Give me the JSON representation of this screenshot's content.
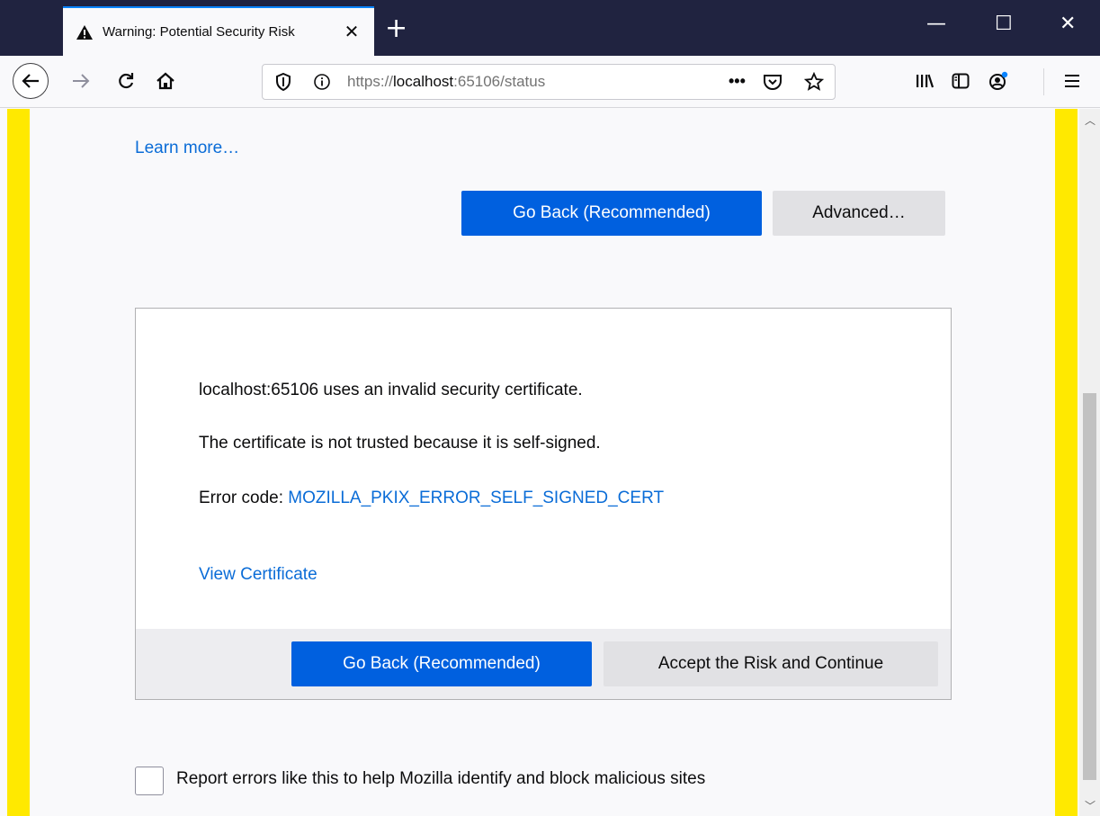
{
  "browser": {
    "tab_title": "Warning: Potential Security Risk",
    "tab_close": "✕",
    "new_tab": "+",
    "window_controls": {
      "minimize": "—",
      "maximize": "☐",
      "close": "✕"
    },
    "url": {
      "prefix": "https://",
      "host": "localhost",
      "rest": ":65106/status"
    },
    "icons": [
      "warning-icon",
      "back-icon",
      "forward-icon",
      "reload-icon",
      "home-icon",
      "shield-icon",
      "info-icon",
      "more-actions-icon",
      "pocket-icon",
      "bookmark-star-icon",
      "library-icon",
      "sidebar-icon",
      "account-icon",
      "menu-icon"
    ]
  },
  "page": {
    "learn_more": "Learn more…",
    "go_back_label": "Go Back (Recommended)",
    "advanced_label": "Advanced…",
    "panel": {
      "line1": "localhost:65106 uses an invalid security certificate.",
      "line2": "The certificate is not trusted because it is self-signed.",
      "error_prefix": "Error code: ",
      "error_code": "MOZILLA_PKIX_ERROR_SELF_SIGNED_CERT",
      "view_certificate": "View Certificate",
      "go_back_label": "Go Back (Recommended)",
      "accept_label": "Accept the Risk and Continue"
    },
    "report_label": "Report errors like this to help Mozilla identify and block malicious sites",
    "report_checked": false
  },
  "colors": {
    "accent": "#0060df",
    "link": "#0a6cd7",
    "stripe": "#ffe900",
    "titlebar": "#202340"
  }
}
